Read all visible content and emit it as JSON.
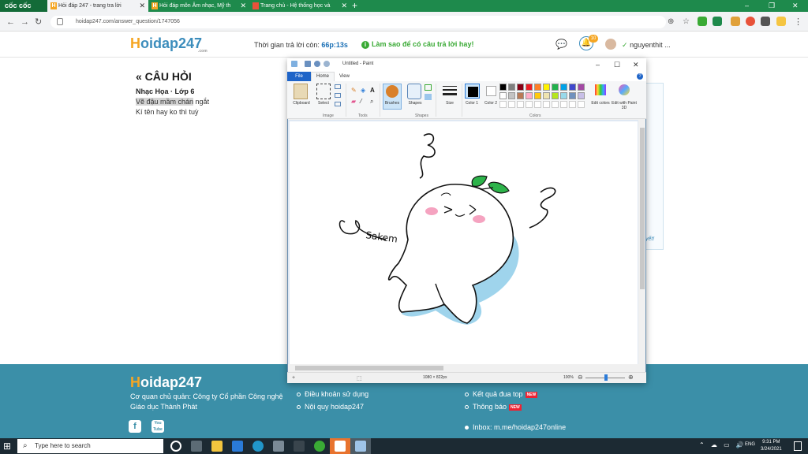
{
  "browser": {
    "brand": "cốc cốc",
    "tabs": [
      {
        "title": "Hỏi đáp 247 - trang tra lời",
        "active": true
      },
      {
        "title": "Hỏi đáp môn Âm nhạc, Mỹ th",
        "active": false
      },
      {
        "title": "Trang chủ - Hệ thống học và",
        "active": false
      }
    ],
    "url": "hoidap247.com/answer_question/1747056"
  },
  "site": {
    "logo_main": "oidap247",
    "logo_h": "H",
    "logo_sub": ".com",
    "timer_label": "Thời gian trả lời còn:",
    "timer_value": "66p:13s",
    "howto": "Làm sao để có câu trả lời hay!",
    "bell_count": "10",
    "username": "nguyenthit ..."
  },
  "question": {
    "heading": "« CÂU HỎI",
    "subject": "Nhạc Họa · Lớp 6",
    "line1_highlight": "Vẽ đậu mầm chán",
    "line1_rest": " ngắt",
    "line2": "Kí tên hay ko thì tuỳ",
    "side_link": "yết!"
  },
  "paint": {
    "title": "Untitled - Paint",
    "tabs": {
      "file": "File",
      "home": "Home",
      "view": "View"
    },
    "tools": {
      "clipboard": "Clipboard",
      "select": "Select",
      "brushes": "Brushes",
      "shapes": "Shapes",
      "size": "Size",
      "color1": "Color 1",
      "color2": "Color 2",
      "edit_colors": "Edit colors",
      "edit_paint3d": "Edit with Paint 3D"
    },
    "groups": {
      "image": "Image",
      "tools": "Tools",
      "shapes": "Shapes",
      "colors": "Colors"
    },
    "palette": [
      "#000000",
      "#7f7f7f",
      "#880015",
      "#ed1c24",
      "#ff7f27",
      "#fff200",
      "#22b14c",
      "#00a2e8",
      "#3f48cc",
      "#a349a4",
      "#ffffff",
      "#c3c3c3",
      "#b97a57",
      "#ffaec9",
      "#ffc90e",
      "#efe4b0",
      "#b5e61d",
      "#99d9ea",
      "#7092be",
      "#c8bfe7"
    ],
    "canvas_size": "1080 × 822px",
    "zoom": "100%",
    "signature": "Sakem"
  },
  "footer": {
    "logo_main": "oidap247",
    "logo_h": "H",
    "org_line1": "Cơ quan chủ quản: Công ty Cổ phần Công nghệ",
    "org_line2": "Giáo dục Thành Phát",
    "links_col1": [
      "Điều khoản sử dụng",
      "Nội quy hoidap247"
    ],
    "links_col2": [
      {
        "text": "Kết quả đua top",
        "badge": "NEW"
      },
      {
        "text": "Thông báo",
        "badge": "NEW"
      }
    ],
    "inbox": "Inbox: m.me/hoidap247online",
    "social": [
      "f",
      "You Tube"
    ]
  },
  "taskbar": {
    "search_placeholder": "Type here to search",
    "time": "9:31 PM",
    "date": "3/24/2021",
    "lang": "ENG"
  }
}
